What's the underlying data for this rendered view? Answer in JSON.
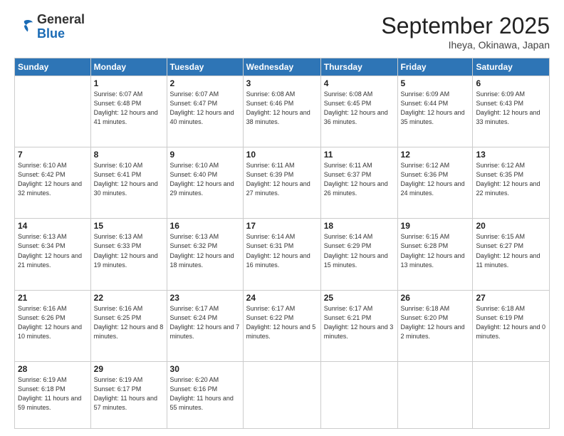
{
  "header": {
    "logo_general": "General",
    "logo_blue": "Blue",
    "month": "September 2025",
    "location": "Iheya, Okinawa, Japan"
  },
  "weekdays": [
    "Sunday",
    "Monday",
    "Tuesday",
    "Wednesday",
    "Thursday",
    "Friday",
    "Saturday"
  ],
  "weeks": [
    [
      null,
      {
        "day": "1",
        "sunrise": "6:07 AM",
        "sunset": "6:48 PM",
        "daylight": "12 hours and 41 minutes."
      },
      {
        "day": "2",
        "sunrise": "6:07 AM",
        "sunset": "6:47 PM",
        "daylight": "12 hours and 40 minutes."
      },
      {
        "day": "3",
        "sunrise": "6:08 AM",
        "sunset": "6:46 PM",
        "daylight": "12 hours and 38 minutes."
      },
      {
        "day": "4",
        "sunrise": "6:08 AM",
        "sunset": "6:45 PM",
        "daylight": "12 hours and 36 minutes."
      },
      {
        "day": "5",
        "sunrise": "6:09 AM",
        "sunset": "6:44 PM",
        "daylight": "12 hours and 35 minutes."
      },
      {
        "day": "6",
        "sunrise": "6:09 AM",
        "sunset": "6:43 PM",
        "daylight": "12 hours and 33 minutes."
      }
    ],
    [
      {
        "day": "7",
        "sunrise": "6:10 AM",
        "sunset": "6:42 PM",
        "daylight": "12 hours and 32 minutes."
      },
      {
        "day": "8",
        "sunrise": "6:10 AM",
        "sunset": "6:41 PM",
        "daylight": "12 hours and 30 minutes."
      },
      {
        "day": "9",
        "sunrise": "6:10 AM",
        "sunset": "6:40 PM",
        "daylight": "12 hours and 29 minutes."
      },
      {
        "day": "10",
        "sunrise": "6:11 AM",
        "sunset": "6:39 PM",
        "daylight": "12 hours and 27 minutes."
      },
      {
        "day": "11",
        "sunrise": "6:11 AM",
        "sunset": "6:37 PM",
        "daylight": "12 hours and 26 minutes."
      },
      {
        "day": "12",
        "sunrise": "6:12 AM",
        "sunset": "6:36 PM",
        "daylight": "12 hours and 24 minutes."
      },
      {
        "day": "13",
        "sunrise": "6:12 AM",
        "sunset": "6:35 PM",
        "daylight": "12 hours and 22 minutes."
      }
    ],
    [
      {
        "day": "14",
        "sunrise": "6:13 AM",
        "sunset": "6:34 PM",
        "daylight": "12 hours and 21 minutes."
      },
      {
        "day": "15",
        "sunrise": "6:13 AM",
        "sunset": "6:33 PM",
        "daylight": "12 hours and 19 minutes."
      },
      {
        "day": "16",
        "sunrise": "6:13 AM",
        "sunset": "6:32 PM",
        "daylight": "12 hours and 18 minutes."
      },
      {
        "day": "17",
        "sunrise": "6:14 AM",
        "sunset": "6:31 PM",
        "daylight": "12 hours and 16 minutes."
      },
      {
        "day": "18",
        "sunrise": "6:14 AM",
        "sunset": "6:29 PM",
        "daylight": "12 hours and 15 minutes."
      },
      {
        "day": "19",
        "sunrise": "6:15 AM",
        "sunset": "6:28 PM",
        "daylight": "12 hours and 13 minutes."
      },
      {
        "day": "20",
        "sunrise": "6:15 AM",
        "sunset": "6:27 PM",
        "daylight": "12 hours and 11 minutes."
      }
    ],
    [
      {
        "day": "21",
        "sunrise": "6:16 AM",
        "sunset": "6:26 PM",
        "daylight": "12 hours and 10 minutes."
      },
      {
        "day": "22",
        "sunrise": "6:16 AM",
        "sunset": "6:25 PM",
        "daylight": "12 hours and 8 minutes."
      },
      {
        "day": "23",
        "sunrise": "6:17 AM",
        "sunset": "6:24 PM",
        "daylight": "12 hours and 7 minutes."
      },
      {
        "day": "24",
        "sunrise": "6:17 AM",
        "sunset": "6:22 PM",
        "daylight": "12 hours and 5 minutes."
      },
      {
        "day": "25",
        "sunrise": "6:17 AM",
        "sunset": "6:21 PM",
        "daylight": "12 hours and 3 minutes."
      },
      {
        "day": "26",
        "sunrise": "6:18 AM",
        "sunset": "6:20 PM",
        "daylight": "12 hours and 2 minutes."
      },
      {
        "day": "27",
        "sunrise": "6:18 AM",
        "sunset": "6:19 PM",
        "daylight": "12 hours and 0 minutes."
      }
    ],
    [
      {
        "day": "28",
        "sunrise": "6:19 AM",
        "sunset": "6:18 PM",
        "daylight": "11 hours and 59 minutes."
      },
      {
        "day": "29",
        "sunrise": "6:19 AM",
        "sunset": "6:17 PM",
        "daylight": "11 hours and 57 minutes."
      },
      {
        "day": "30",
        "sunrise": "6:20 AM",
        "sunset": "6:16 PM",
        "daylight": "11 hours and 55 minutes."
      },
      null,
      null,
      null,
      null
    ]
  ]
}
